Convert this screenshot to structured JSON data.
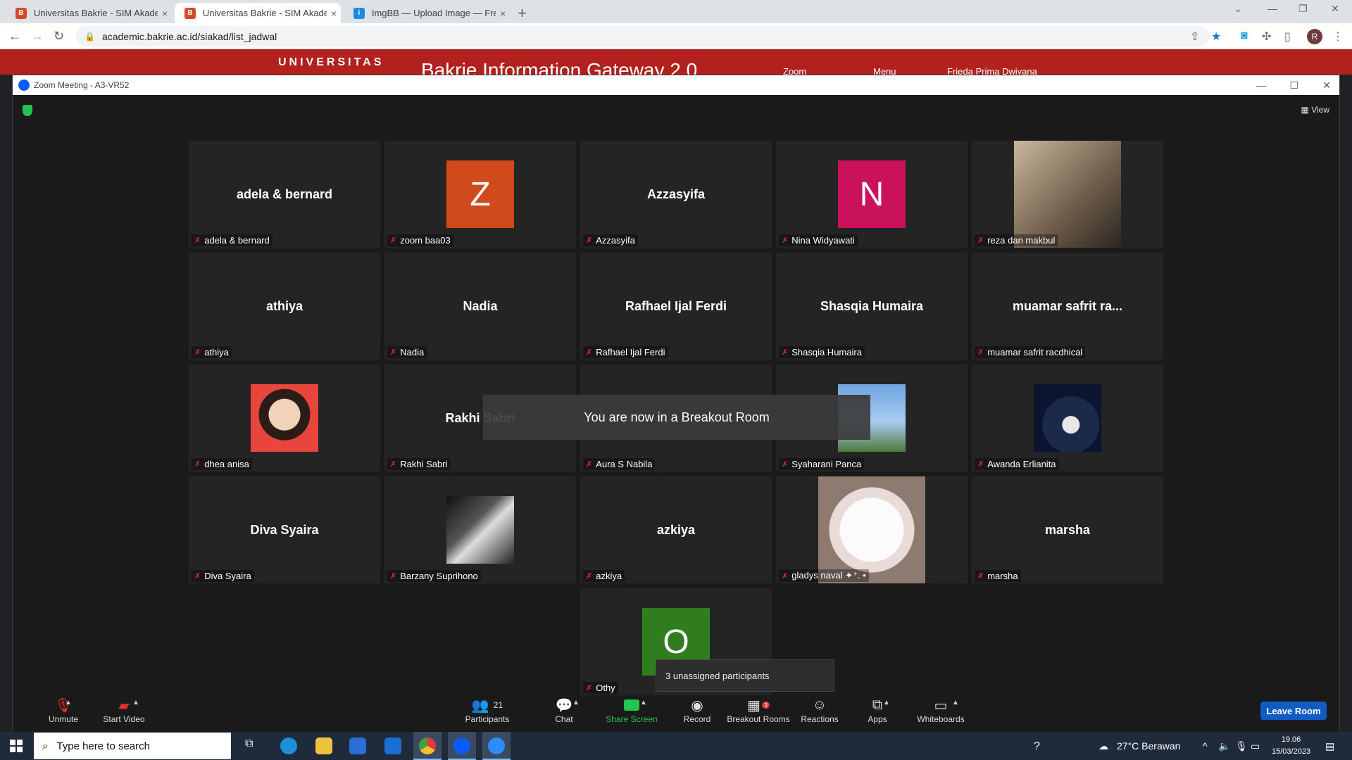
{
  "browser": {
    "tabs": [
      {
        "title": "Universitas Bakrie - SIM Akadem",
        "close": "×"
      },
      {
        "title": "Universitas Bakrie - SIM Akadem",
        "close": "×"
      },
      {
        "title": "ImgBB — Upload Image — Free",
        "close": "×"
      }
    ],
    "new_tab": "+",
    "url": "academic.bakrie.ac.id/siakad/list_jadwal",
    "profile_initial": "R"
  },
  "site": {
    "logo_text": "UNIVERSITAS",
    "gateway_title": "Bakrie Information Gateway 2.0",
    "nav_zoom": "Zoom",
    "nav_menu": "Menu",
    "nav_user": "Frieda Prima Dwiyana"
  },
  "zoom": {
    "window_title": "Zoom Meeting - A3-VR52",
    "view_label": "View",
    "toast": "You are now in a Breakout Room",
    "tooltip": "3 unassigned participants",
    "participants_count": "21",
    "breakout_badge": "3",
    "leave_label": "Leave Room",
    "controls": {
      "unmute": "Unmute",
      "start_video": "Start Video",
      "participants": "Participants",
      "chat": "Chat",
      "share_screen": "Share Screen",
      "record": "Record",
      "breakout_rooms": "Breakout Rooms",
      "reactions": "Reactions",
      "apps": "Apps",
      "whiteboards": "Whiteboards"
    },
    "tiles": [
      {
        "display": "adela & bernard",
        "label": "adela & bernard",
        "kind": "name"
      },
      {
        "display": "Z",
        "label": "zoom baa03",
        "kind": "initial",
        "color": "#d04a1c"
      },
      {
        "display": "Azzasyifa",
        "label": "Azzasyifa",
        "kind": "name"
      },
      {
        "display": "N",
        "label": "Nina Widyawati",
        "kind": "initial",
        "color": "#c9115c"
      },
      {
        "display": "",
        "label": "reza dan makbul",
        "kind": "photo"
      },
      {
        "display": "athiya",
        "label": "athiya",
        "kind": "name"
      },
      {
        "display": "Nadia",
        "label": "Nadia",
        "kind": "name"
      },
      {
        "display": "Rafhael Ijal Ferdi",
        "label": "Rafhael Ijal Ferdi",
        "kind": "name"
      },
      {
        "display": "Shasqia Humaira",
        "label": "Shasqia Humaira",
        "kind": "name"
      },
      {
        "display": "muamar safrit ra...",
        "label": "muamar safrit racdhical",
        "kind": "name"
      },
      {
        "display": "",
        "label": "dhea anisa",
        "kind": "photo"
      },
      {
        "display": "Rakhi Sabri",
        "label": "Rakhi Sabri",
        "kind": "name"
      },
      {
        "display": "",
        "label": "Aura S Nabila",
        "kind": "name"
      },
      {
        "display": "",
        "label": "Syaharani Panca",
        "kind": "photo"
      },
      {
        "display": "",
        "label": "Awanda Erlianita",
        "kind": "photo"
      },
      {
        "display": "Diva Syaira",
        "label": "Diva Syaira",
        "kind": "name"
      },
      {
        "display": "",
        "label": "Barzany Suprihono",
        "kind": "photo"
      },
      {
        "display": "azkiya",
        "label": "azkiya",
        "kind": "name"
      },
      {
        "display": "",
        "label": "gladys naval ✦⁺. •",
        "kind": "photo"
      },
      {
        "display": "marsha",
        "label": "marsha",
        "kind": "name"
      },
      {
        "display": "O",
        "label": "Othy",
        "kind": "initial",
        "color": "#2f7d1e"
      }
    ]
  },
  "taskbar": {
    "search_placeholder": "Type here to search",
    "weather": "27°C Berawan",
    "time": "19.06",
    "date": "15/03/2023"
  }
}
